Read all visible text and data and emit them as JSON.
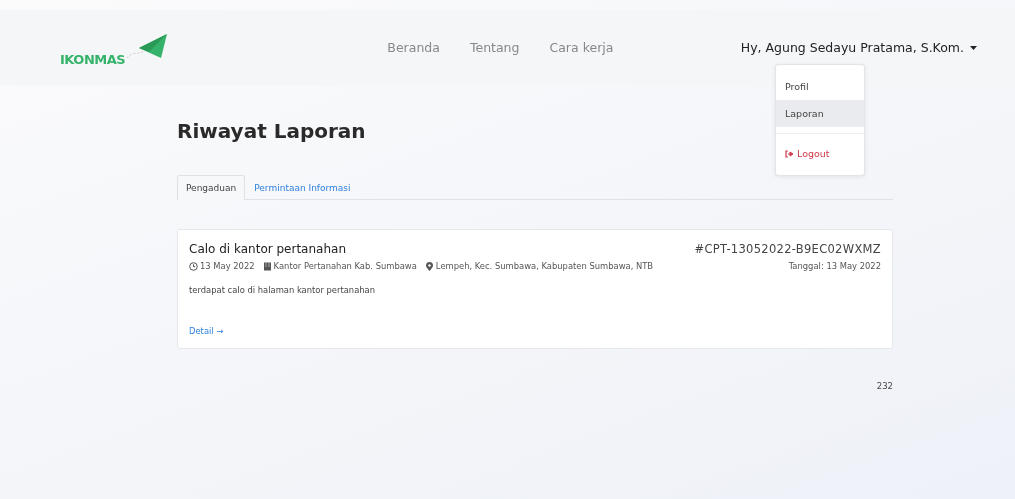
{
  "navbar": {
    "logo": "IKONMAS",
    "links": [
      "Beranda",
      "Tentang",
      "Cara kerja"
    ],
    "user": "Hy, Agung Sedayu Pratama, S.Kom.",
    "user_menu": {
      "expanded": true,
      "items": [
        {
          "label": "Profil",
          "kind": "item",
          "selected": false
        },
        {
          "label": "Laporan",
          "kind": "item",
          "selected": true
        },
        {
          "label": "Logout",
          "kind": "logout",
          "selected": false
        }
      ]
    }
  },
  "page_title": "Riwayat Laporan",
  "tabs": [
    {
      "label": "Pengaduan",
      "selected": true
    },
    {
      "label": "Permintaan Informasi",
      "selected": false
    }
  ],
  "reports": [
    {
      "title": "Calo di kantor pertanahan",
      "code": "#CPT-13052022-B9EC02WXMZ",
      "date": "13 May 2022",
      "office": "Kantor Pertanahan Kab. Sumbawa",
      "location": "Lempeh, Kec. Sumbawa, Kabupaten Sumbawa, NTB",
      "issued": "Tanggal: 13 May 2022",
      "description": "terdapat calo di halaman kantor pertanahan",
      "link": "Detail →"
    }
  ],
  "footer_number": "232"
}
